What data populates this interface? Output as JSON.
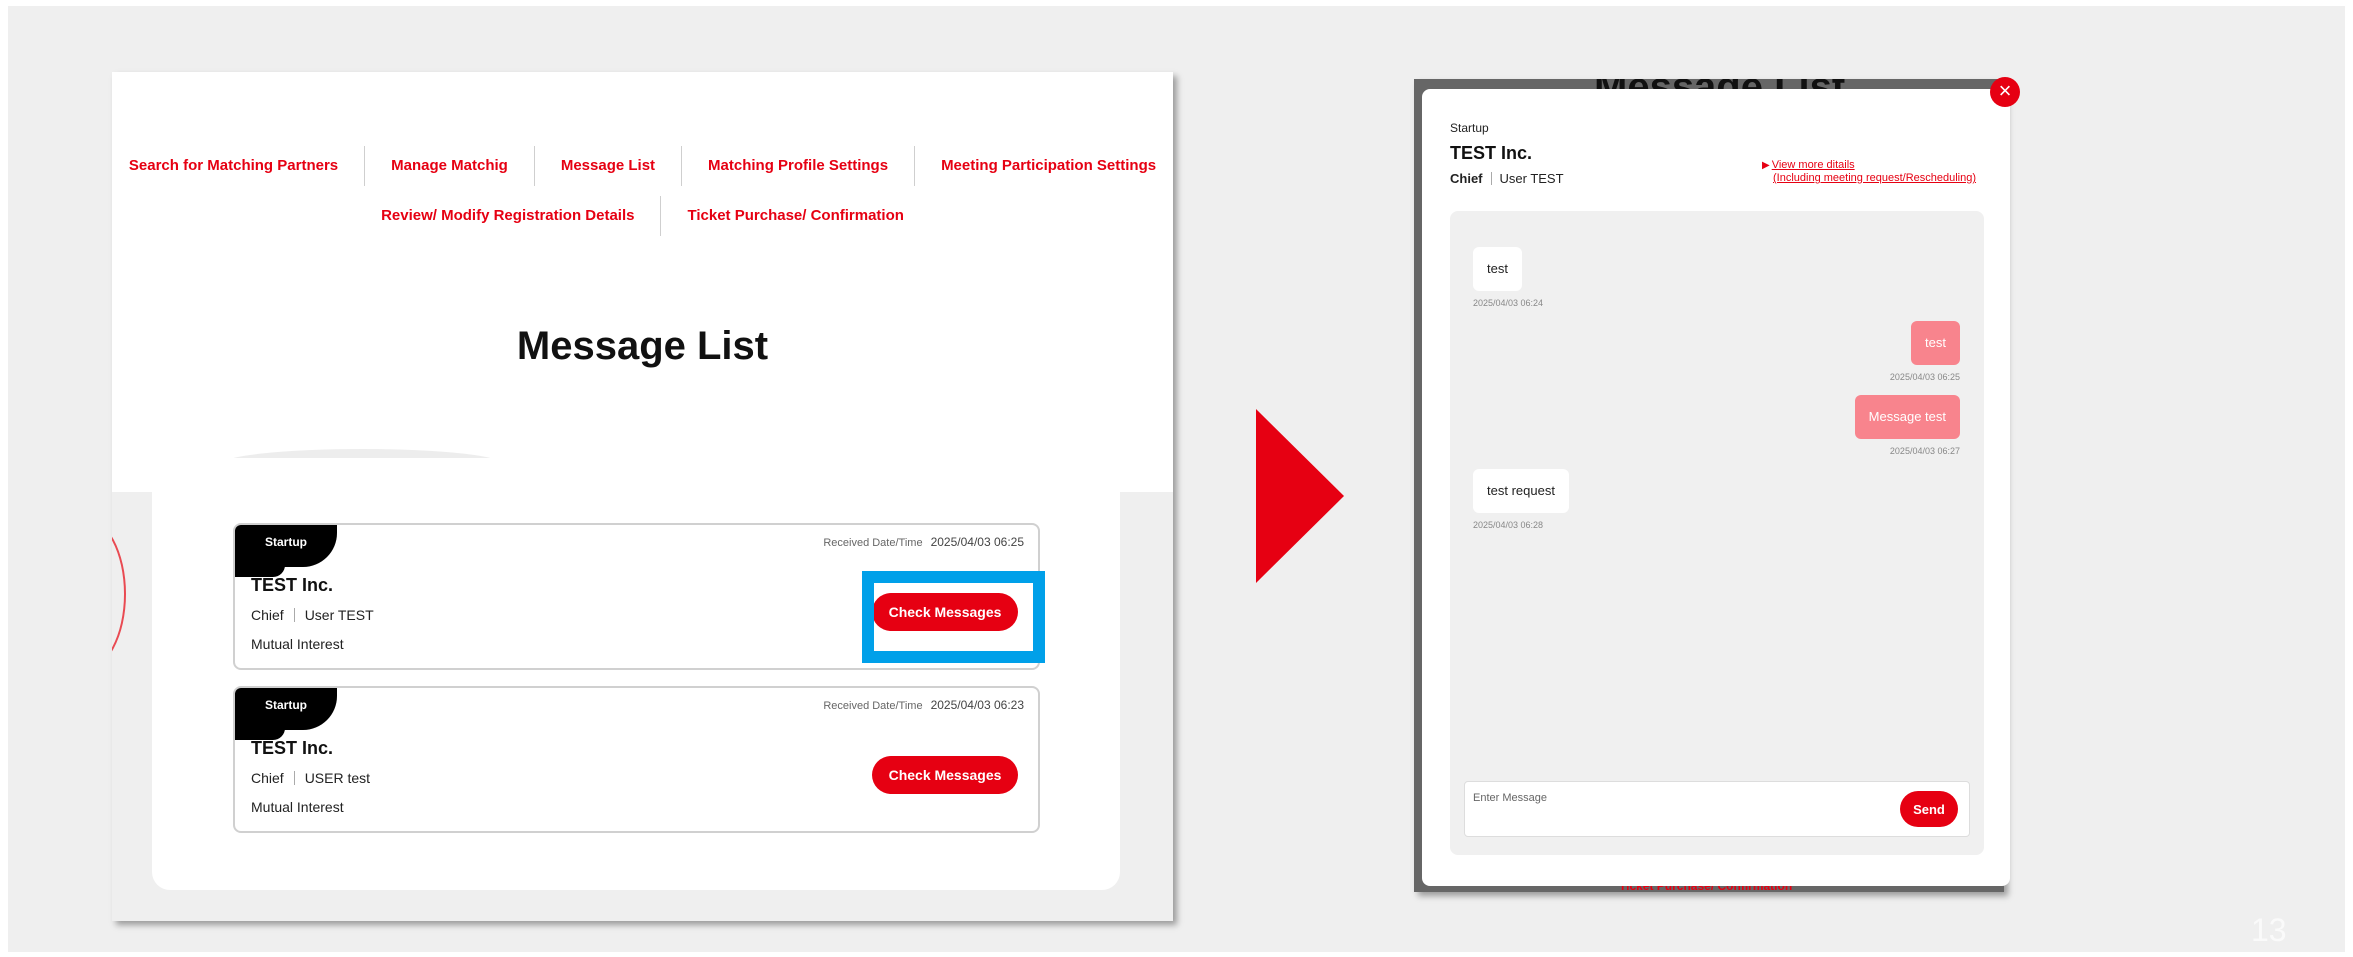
{
  "nav": {
    "row1": [
      "Search for Matching Partners",
      "Manage Matchig",
      "Message List",
      "Matching Profile Settings",
      "Meeting Participation Settings"
    ],
    "row2": [
      "Review/ Modify Registration Details",
      "Ticket Purchase/ Confirmation"
    ]
  },
  "page_title": "Message List",
  "cards": [
    {
      "tag": "Startup",
      "received_label": "Received Date/Time",
      "received_date": "2025/04/03 06:25",
      "company": "TEST Inc.",
      "position": "Chief",
      "user": "User TEST",
      "status": "Mutual Interest",
      "button": "Check Messages"
    },
    {
      "tag": "Startup",
      "received_label": "Received Date/Time",
      "received_date": "2025/04/03 06:23",
      "company": "TEST Inc.",
      "position": "Chief",
      "user": "USER test",
      "status": "Mutual Interest",
      "button": "Check Messages"
    }
  ],
  "modal": {
    "background_title": "Message List",
    "background_footer": "Ticket Purchase/ Confirmation",
    "close": "×",
    "category": "Startup",
    "company": "TEST Inc.",
    "position": "Chief",
    "user": "User TEST",
    "details_marker": "▶",
    "details_link_line1": "View more ditails",
    "details_link_line2": "(Including meeting request/Rescheduling)",
    "messages": [
      {
        "direction": "in",
        "text": "test",
        "time": "2025/04/03 06:24"
      },
      {
        "direction": "out",
        "text": "test",
        "time": "2025/04/03 06:25"
      },
      {
        "direction": "out",
        "text": "Message test",
        "time": "2025/04/03 06:27"
      },
      {
        "direction": "in",
        "text": "test request",
        "time": "2025/04/03 06:28"
      }
    ],
    "input_placeholder": "Enter Message",
    "send_label": "Send"
  },
  "slide_number": "13",
  "colors": {
    "accent": "#e60012",
    "highlight": "#00a0e9",
    "outgoing_bubble": "#f8848d"
  },
  "icons": {
    "arrow": "right-triangle-arrow-icon",
    "close": "close-icon"
  }
}
